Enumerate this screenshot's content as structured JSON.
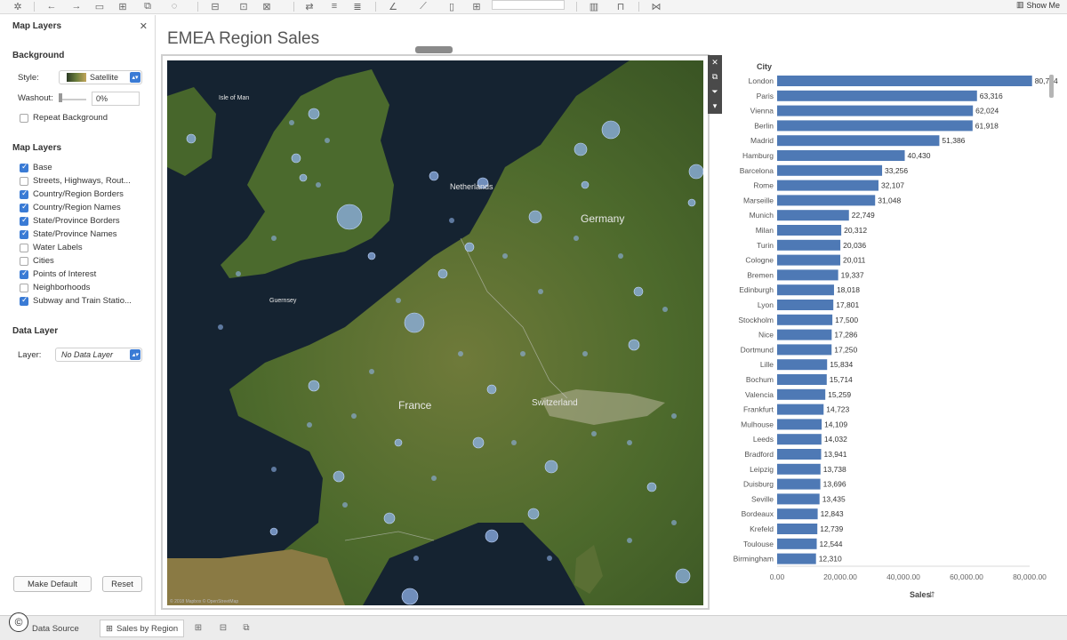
{
  "toolbar": {
    "icons": [
      "tableau-icon",
      "back-icon",
      "forward-icon",
      "save-icon",
      "new-datasource-icon",
      "pause-icon",
      "new-worksheet-icon",
      "duplicate-icon",
      "clear-icon",
      "swap-icon",
      "sort-ascending-icon",
      "sort-descending-icon",
      "highlight-icon",
      "label-icon",
      "fix-axes-icon",
      "group-icon",
      "fit-dropdown",
      "show-cards-icon",
      "presentation-icon",
      "share-icon"
    ],
    "show_me_label": "Show Me"
  },
  "left_panel": {
    "title": "Map Layers",
    "background_section": "Background",
    "style_label": "Style:",
    "style_value": "Satellite",
    "washout_label": "Washout:",
    "washout_value": "0%",
    "washout_level_percent": 0,
    "repeat_background_label": "Repeat Background",
    "repeat_background_checked": false,
    "map_layers_section": "Map Layers",
    "layers": [
      {
        "label": "Base",
        "checked": true
      },
      {
        "label": "Streets, Highways, Rout...",
        "checked": false
      },
      {
        "label": "Country/Region Borders",
        "checked": true
      },
      {
        "label": "Country/Region Names",
        "checked": true
      },
      {
        "label": "State/Province Borders",
        "checked": true
      },
      {
        "label": "State/Province Names",
        "checked": true
      },
      {
        "label": "Water Labels",
        "checked": false
      },
      {
        "label": "Cities",
        "checked": false
      },
      {
        "label": "Points of Interest",
        "checked": true
      },
      {
        "label": "Neighborhoods",
        "checked": false
      },
      {
        "label": "Subway and Train Statio...",
        "checked": true
      }
    ],
    "data_layer_section": "Data Layer",
    "layer_label": "Layer:",
    "layer_value": "No Data Layer",
    "make_default_label": "Make Default",
    "reset_label": "Reset"
  },
  "sheet_title": "EMEA Region Sales",
  "map": {
    "labels": {
      "isle_of_man": "Isle of Man",
      "netherlands": "Netherlands",
      "germany": "Germany",
      "france": "France",
      "switzerland": "Switzerland",
      "guernsey": "Guernsey"
    },
    "attribution": "© 2018 Mapbox © OpenStreetMap"
  },
  "chart_data": {
    "type": "bar",
    "orientation": "horizontal",
    "title": "",
    "row_header": "City",
    "xlabel": "Sales",
    "xlim": [
      0,
      80000
    ],
    "xticks": [
      "0.00",
      "20,000.00",
      "40,000.00",
      "60,000.00",
      "80,000.00"
    ],
    "bar_color": "#4e79b5",
    "categories": [
      "London",
      "Paris",
      "Vienna",
      "Berlin",
      "Madrid",
      "Hamburg",
      "Barcelona",
      "Rome",
      "Marseille",
      "Munich",
      "Milan",
      "Turin",
      "Cologne",
      "Bremen",
      "Edinburgh",
      "Lyon",
      "Stockholm",
      "Nice",
      "Dortmund",
      "Lille",
      "Bochum",
      "Valencia",
      "Frankfurt",
      "Mulhouse",
      "Leeds",
      "Bradford",
      "Leipzig",
      "Duisburg",
      "Seville",
      "Bordeaux",
      "Krefeld",
      "Toulouse",
      "Birmingham"
    ],
    "values": [
      80764,
      63316,
      62024,
      61918,
      51386,
      40430,
      33256,
      32107,
      31048,
      22749,
      20312,
      20036,
      20011,
      19337,
      18018,
      17801,
      17500,
      17286,
      17250,
      15834,
      15714,
      15259,
      14723,
      14109,
      14032,
      13941,
      13738,
      13696,
      13435,
      12843,
      12739,
      12544,
      12310
    ],
    "labels": [
      "80,764",
      "63,316",
      "62,024",
      "61,918",
      "51,386",
      "40,430",
      "33,256",
      "32,107",
      "31,048",
      "22,749",
      "20,312",
      "20,036",
      "20,011",
      "19,337",
      "18,018",
      "17,801",
      "17,500",
      "17,286",
      "17,250",
      "15,834",
      "15,714",
      "15,259",
      "14,723",
      "14,109",
      "14,032",
      "13,941",
      "13,738",
      "13,696",
      "13,435",
      "12,843",
      "12,739",
      "12,544",
      "12,310"
    ]
  },
  "status_bar": {
    "data_source_label": "Data Source",
    "sheet_tab_label": "Sales by Region",
    "copyright_symbol": "©"
  }
}
